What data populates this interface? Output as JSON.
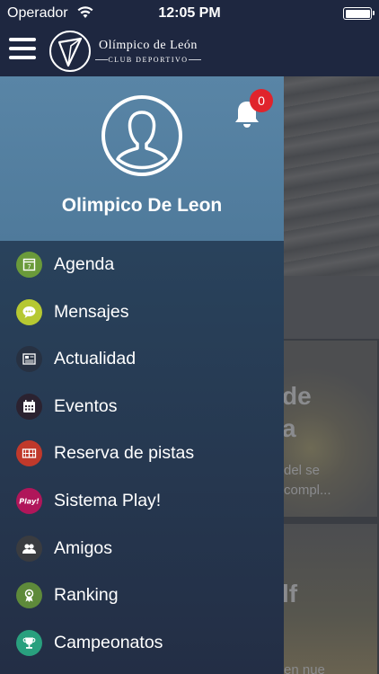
{
  "status_bar": {
    "carrier": "Operador",
    "time": "12:05 PM"
  },
  "header": {
    "logo_name": "Olímpico de León",
    "logo_sub": "CLUB DEPORTIVO"
  },
  "drawer": {
    "profile_name": "Olimpico De Leon",
    "notification_count": "0",
    "menu": [
      {
        "label": "Agenda",
        "icon": "calendar-icon",
        "color": "#6a9a3a"
      },
      {
        "label": "Mensajes",
        "icon": "chat-bubble-icon",
        "color": "#b6c832"
      },
      {
        "label": "Actualidad",
        "icon": "newspaper-icon",
        "color": "#273142"
      },
      {
        "label": "Eventos",
        "icon": "calendar-grid-icon",
        "color": "#2b2230"
      },
      {
        "label": "Reserva de pistas",
        "icon": "court-icon",
        "color": "#c0392b"
      },
      {
        "label": "Sistema Play!",
        "icon": "play-icon",
        "color": "#b0165a"
      },
      {
        "label": "Amigos",
        "icon": "friends-icon",
        "color": "#3a3c40"
      },
      {
        "label": "Ranking",
        "icon": "medal-icon",
        "color": "#5e8a3a"
      },
      {
        "label": "Campeonatos",
        "icon": "trophy-icon",
        "color": "#29a07e"
      }
    ]
  },
  "background": {
    "line1": "de",
    "line2": "a",
    "line3": "del se",
    "line4": "compl...",
    "line5": "lf",
    "line6": "en nue"
  }
}
